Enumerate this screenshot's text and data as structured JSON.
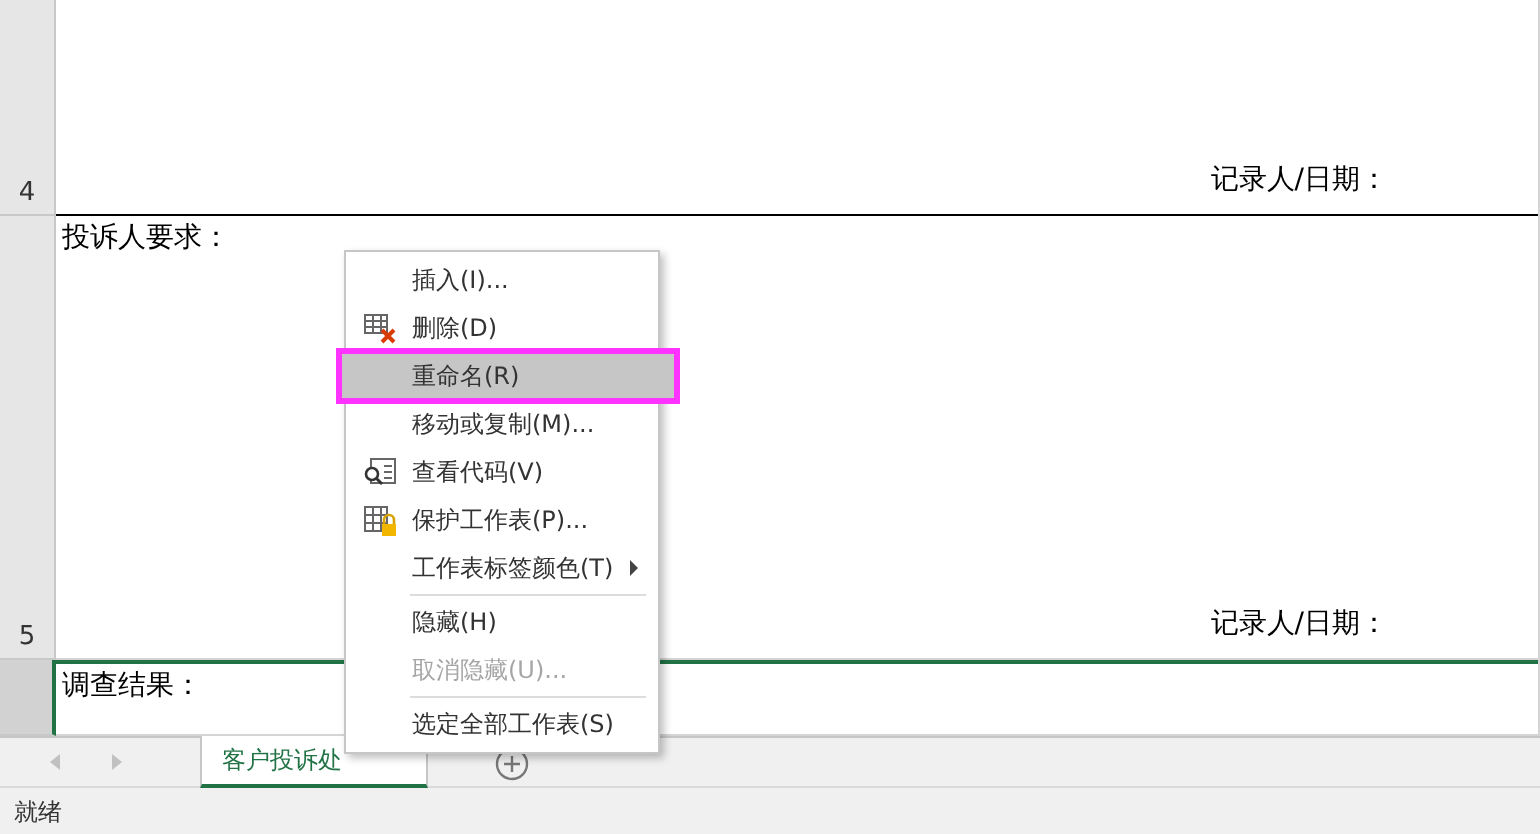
{
  "sheet": {
    "rows": [
      {
        "number": "4",
        "texts": [
          {
            "text": "记录人/日期：",
            "kind": "signature"
          }
        ],
        "selected": false
      },
      {
        "number": "5",
        "texts": [
          {
            "text": "投诉人要求：",
            "kind": "heading"
          },
          {
            "text": "记录人/日期：",
            "kind": "signature"
          }
        ],
        "selected": false
      },
      {
        "number": "",
        "texts": [
          {
            "text": "调查结果：",
            "kind": "heading"
          }
        ],
        "selected": true
      }
    ]
  },
  "sheet_tabs": [
    {
      "label": "客户投诉处",
      "selected": true
    }
  ],
  "context_menu": {
    "items": [
      {
        "kind": "plain",
        "label": "插入(I)...",
        "selected": false,
        "disabled": false
      },
      {
        "kind": "delete",
        "label": "删除(D)",
        "selected": false,
        "disabled": false
      },
      {
        "kind": "plain",
        "label": "重命名(R)",
        "selected": true,
        "disabled": false
      },
      {
        "kind": "plain",
        "label": "移动或复制(M)...",
        "selected": false,
        "disabled": false
      },
      {
        "kind": "code",
        "label": "查看代码(V)",
        "selected": false,
        "disabled": false
      },
      {
        "kind": "protect",
        "label": "保护工作表(P)...",
        "selected": false,
        "disabled": false
      },
      {
        "kind": "submenu",
        "label": "工作表标签颜色(T)",
        "selected": false,
        "disabled": false
      },
      {
        "kind": "separator"
      },
      {
        "kind": "plain",
        "label": "隐藏(H)",
        "selected": false,
        "disabled": false
      },
      {
        "kind": "plain",
        "label": "取消隐藏(U)...",
        "selected": false,
        "disabled": true
      },
      {
        "kind": "separator"
      },
      {
        "kind": "plain",
        "label": "选定全部工作表(S)",
        "selected": false,
        "disabled": false
      }
    ]
  },
  "status_bar": {
    "text": "就绪"
  }
}
